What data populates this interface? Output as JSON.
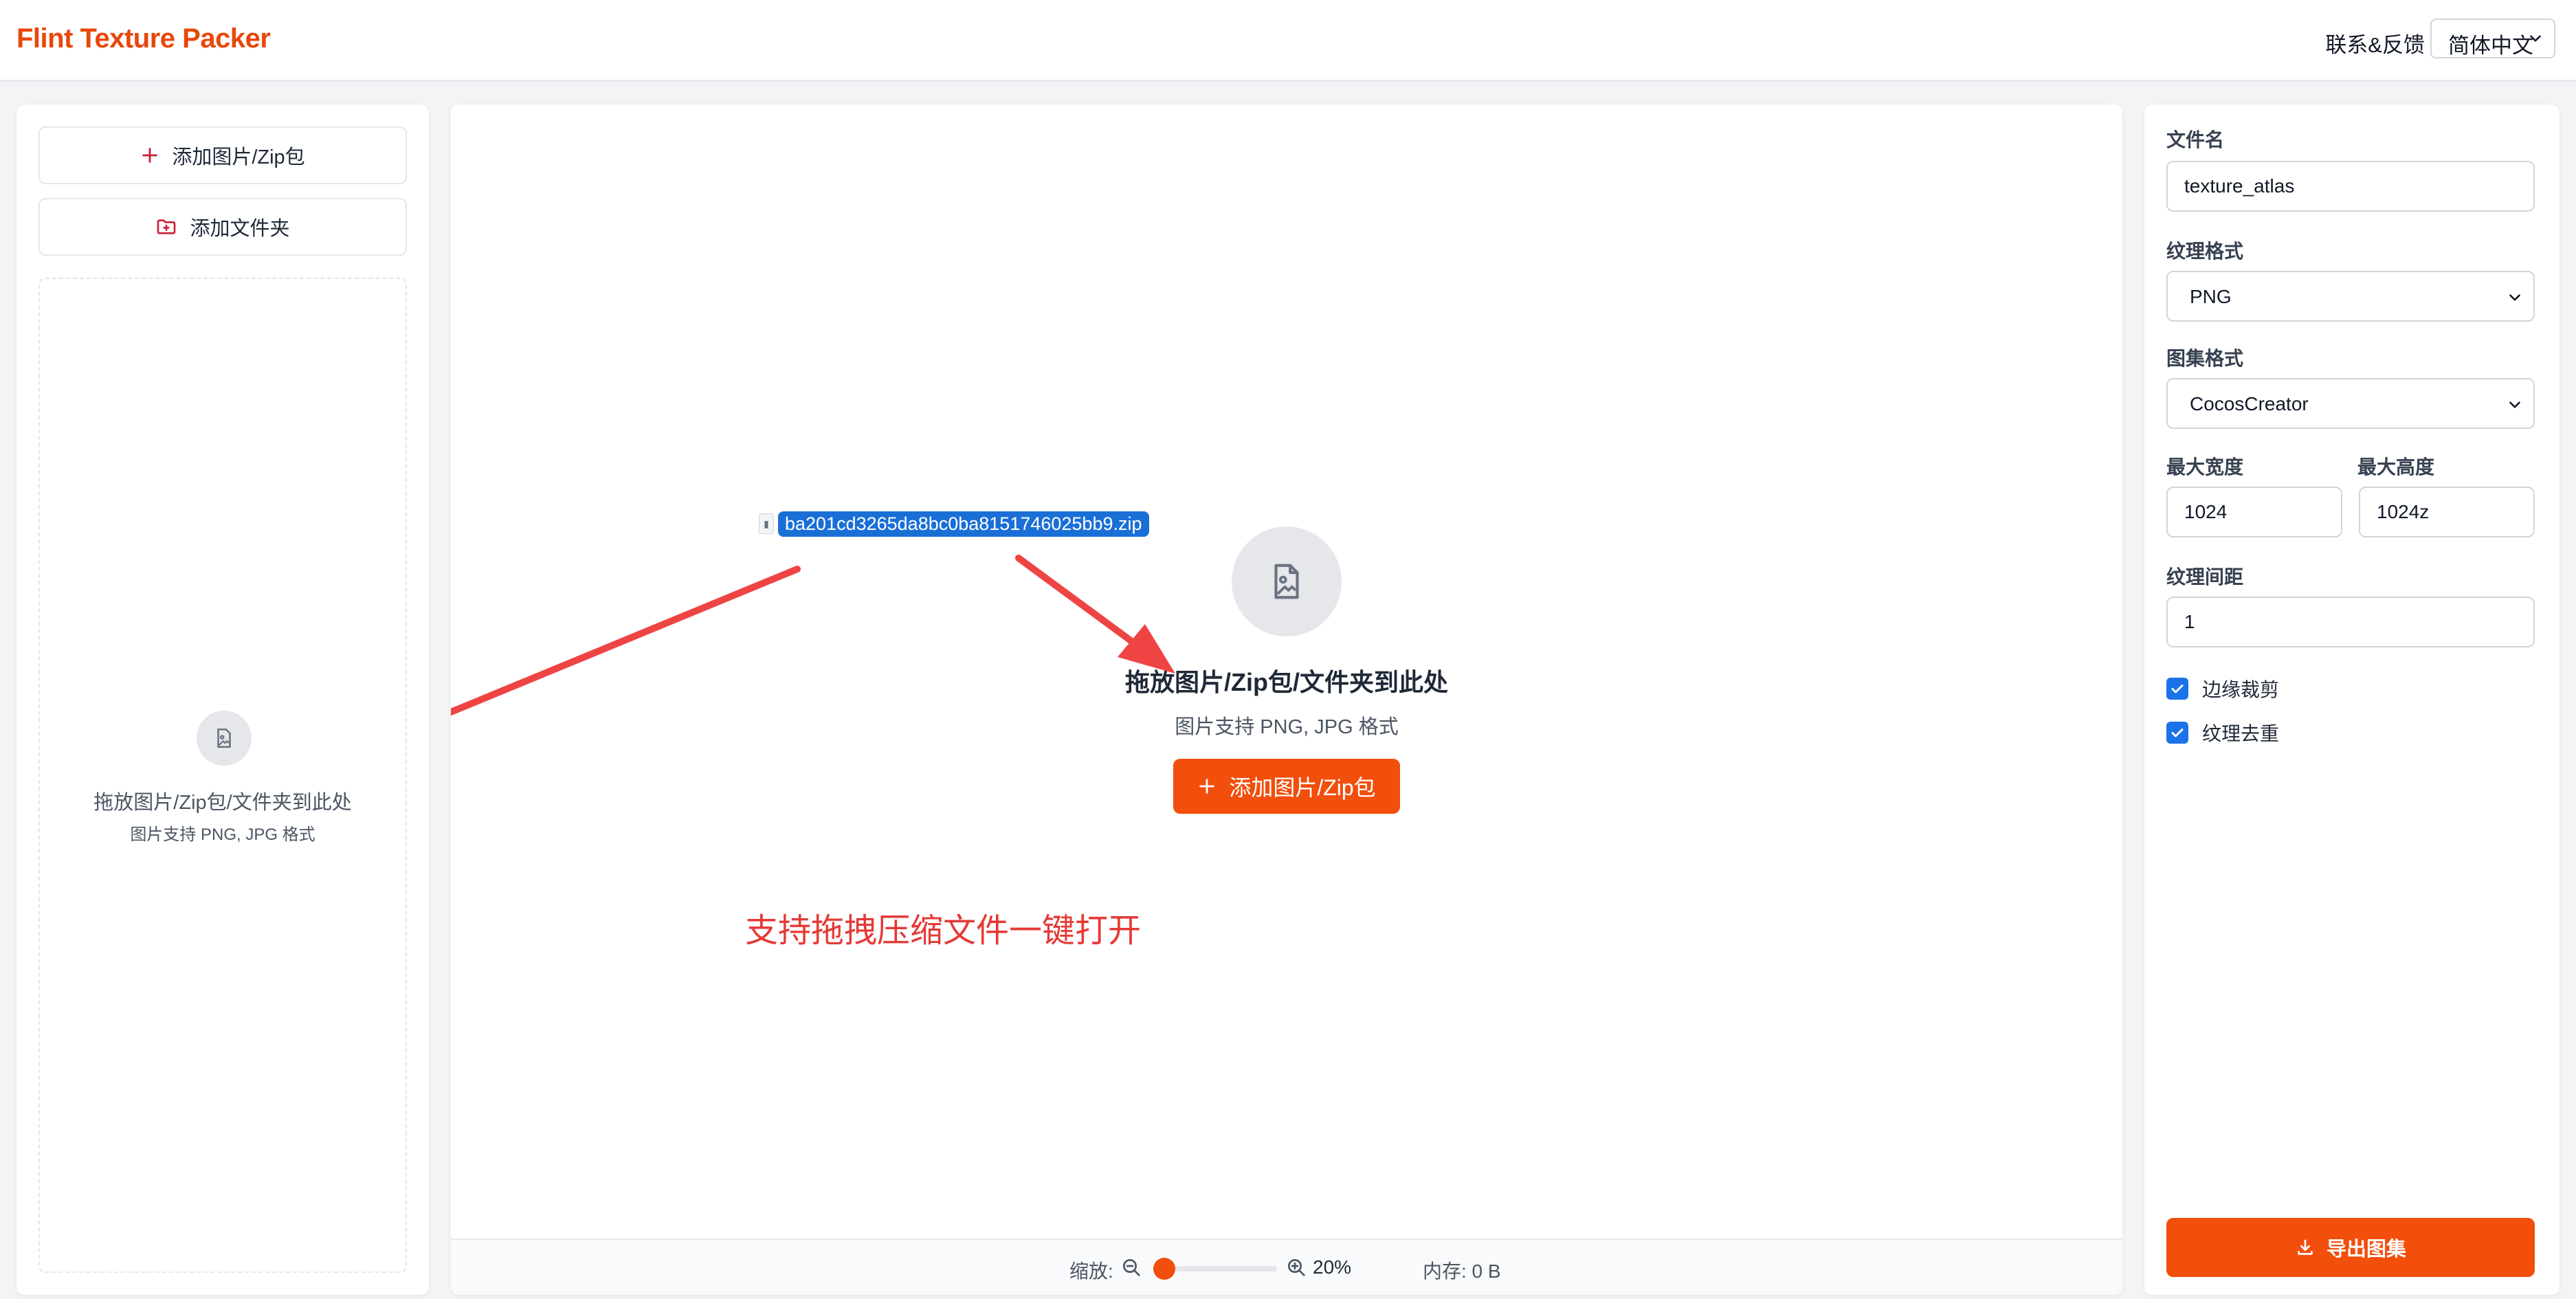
{
  "header": {
    "app_title": "Flint Texture Packer",
    "feedback_link": "联系&反馈",
    "language": "简体中文"
  },
  "sidebar": {
    "add_images_label": "添加图片/Zip包",
    "add_folder_label": "添加文件夹",
    "drop_title": "拖放图片/Zip包/文件夹到此处",
    "drop_subtitle": "图片支持 PNG, JPG 格式"
  },
  "canvas": {
    "drop_title": "拖放图片/Zip包/文件夹到此处",
    "drop_subtitle": "图片支持 PNG, JPG 格式",
    "add_button_label": "添加图片/Zip包",
    "dragged_file_name": "ba201cd3265da8bc0ba8151746025bb9.zip",
    "annotation": "支持拖拽压缩文件一键打开",
    "annotation_color": "#e53935"
  },
  "footer": {
    "zoom_label": "缩放:",
    "zoom_value": "20%",
    "zoom_fraction": 0.0,
    "memory_label": "内存: 0 B"
  },
  "settings": {
    "filename_label": "文件名",
    "filename_value": "texture_atlas",
    "texture_format_label": "纹理格式",
    "texture_format_value": "PNG",
    "atlas_format_label": "图集格式",
    "atlas_format_value": "CocosCreator",
    "max_width_label": "最大宽度",
    "max_width_value": "1024",
    "max_height_label": "最大高度",
    "max_height_value": "1024z",
    "spacing_label": "纹理间距",
    "spacing_value": "1",
    "trim_label": "边缘裁剪",
    "trim_checked": true,
    "dedupe_label": "纹理去重",
    "dedupe_checked": true,
    "export_label": "导出图集"
  },
  "colors": {
    "accent": "#f24e0c",
    "brand_title": "#e8470b",
    "checkbox": "#1a73e8",
    "selection": "#1a6fd6"
  }
}
